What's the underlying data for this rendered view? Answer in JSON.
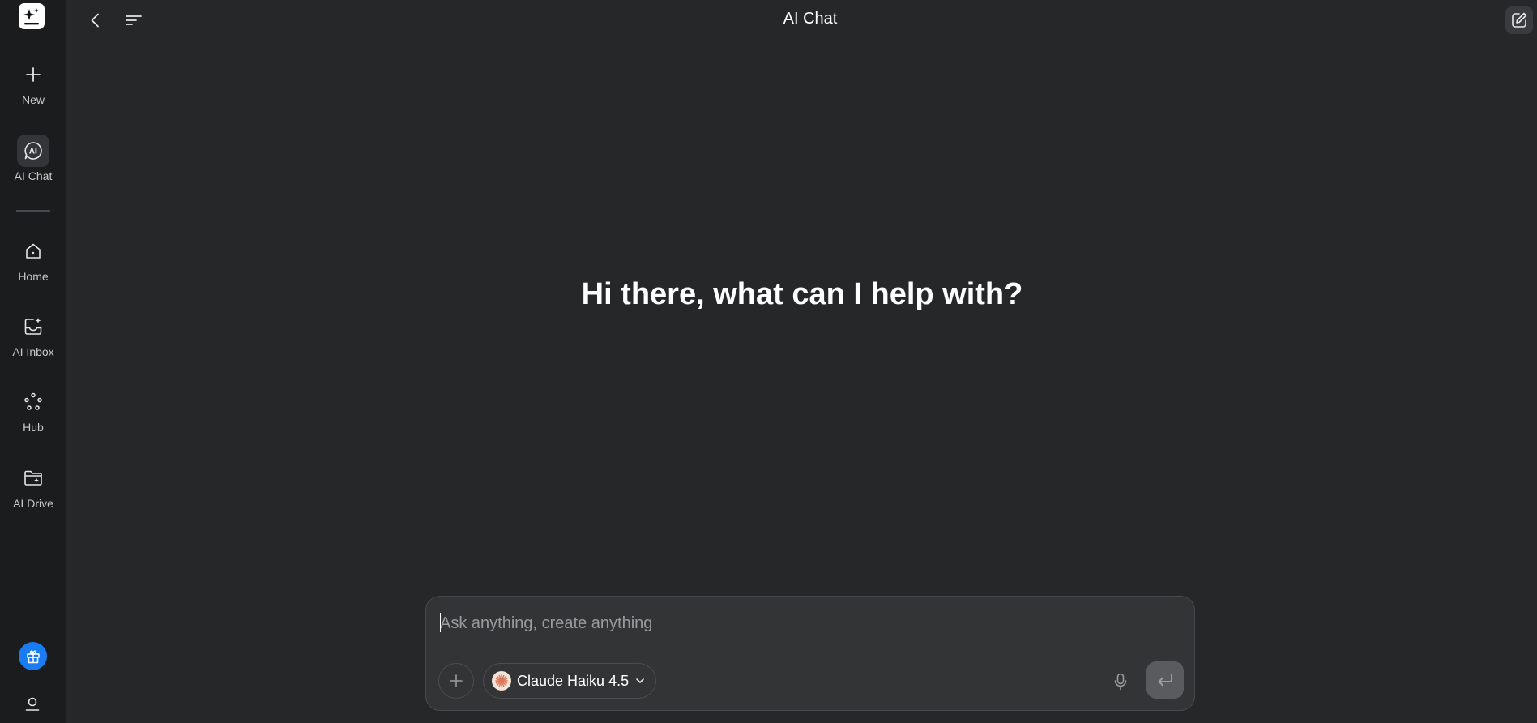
{
  "header": {
    "title": "AI Chat"
  },
  "sidebar": {
    "items": [
      {
        "label": "New",
        "icon": "plus-icon"
      },
      {
        "label": "AI Chat",
        "icon": "ai-chat-icon",
        "active": true
      },
      {
        "label": "Home",
        "icon": "home-icon"
      },
      {
        "label": "AI Inbox",
        "icon": "ai-inbox-icon"
      },
      {
        "label": "Hub",
        "icon": "hub-icon"
      },
      {
        "label": "AI Drive",
        "icon": "ai-drive-icon"
      }
    ]
  },
  "main": {
    "greeting": "Hi there, what can I help with?"
  },
  "composer": {
    "placeholder": "Ask anything, create anything",
    "value": "",
    "model_label": "Claude Haiku 4.5"
  },
  "colors": {
    "background": "#262729",
    "sidebar": "#1b1c1e",
    "accent": "#1a7cf2",
    "model_logo": "#d97757"
  }
}
